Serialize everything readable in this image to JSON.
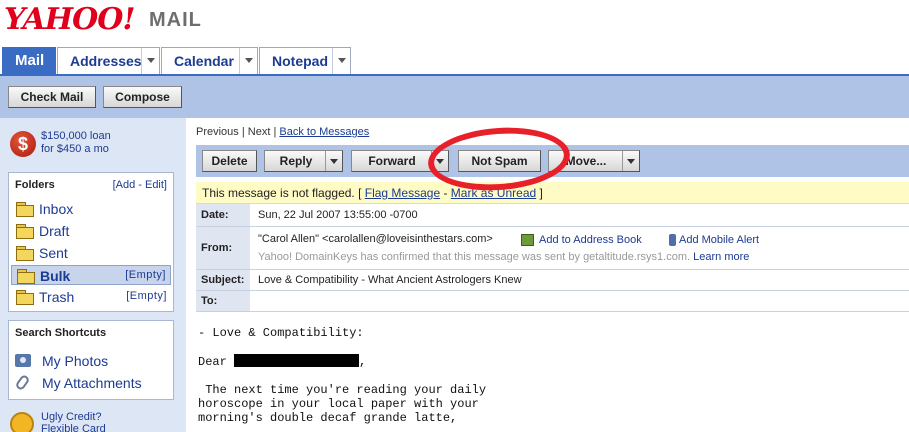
{
  "header": {
    "logo_text": "YAHOO!",
    "product": "MAIL"
  },
  "tabs": [
    {
      "label": "Mail",
      "active": true
    },
    {
      "label": "Addresses"
    },
    {
      "label": "Calendar"
    },
    {
      "label": "Notepad"
    }
  ],
  "toolbar": {
    "check_mail": "Check Mail",
    "compose": "Compose"
  },
  "sidebar": {
    "promo_top": {
      "line1": "$150,000 loan",
      "line2": "for $450 a mo",
      "icon": "dollar-icon"
    },
    "folders_title": "Folders",
    "folders_actions": "[Add - Edit]",
    "folders": [
      {
        "label": "Inbox",
        "empty": ""
      },
      {
        "label": "Draft",
        "empty": ""
      },
      {
        "label": "Sent",
        "empty": ""
      },
      {
        "label": "Bulk",
        "empty": "[Empty]",
        "selected": true
      },
      {
        "label": "Trash",
        "empty": "[Empty]"
      }
    ],
    "shortcuts_title": "Search Shortcuts",
    "shortcuts": [
      {
        "label": "My Photos",
        "icon": "camera-icon"
      },
      {
        "label": "My Attachments",
        "icon": "paperclip-icon"
      }
    ],
    "promo_bottom": {
      "line1": "Ugly Credit?",
      "line2": "Flexible Card"
    }
  },
  "nav": {
    "previous": "Previous",
    "sep1": " | ",
    "next": "Next",
    "sep2": " | ",
    "back": "Back to Messages"
  },
  "actions": {
    "delete": "Delete",
    "reply": "Reply",
    "forward": "Forward",
    "not_spam": "Not Spam",
    "move": "Move..."
  },
  "flag_bar": {
    "text": "This message is not flagged. [ ",
    "flag_link": "Flag Message",
    "dash": " - ",
    "unread_link": "Mark as Unread",
    "close": " ]"
  },
  "message": {
    "date_label": "Date:",
    "date": "Sun, 22 Jul 2007 13:55:00 -0700",
    "from_label": "From:",
    "from": "\"Carol Allen\" <carolallen@loveisinthestars.com>",
    "add_address": "Add to Address Book",
    "add_mobile": "Add Mobile Alert",
    "domainkeys_note": "Yahoo! DomainKeys has confirmed that this message was sent by getaltitude.rsys1.com.",
    "learn_more": "Learn more",
    "subject_label": "Subject:",
    "subject": "Love & Compatibility - What Ancient Astrologers Knew",
    "to_label": "To:",
    "to": ""
  },
  "body": {
    "line1": "- Love & Compatibility:",
    "dear": "Dear ",
    "dear_after": ",",
    "para": " The next time you're reading your daily\nhoroscope in your local paper with your\nmorning's double decaf grande latte,"
  },
  "colors": {
    "brand_red": "#e0001b",
    "tab_blue": "#3a6cc4",
    "band_blue": "#aec3e6",
    "link_blue": "#1c3b92",
    "annotation_red": "#e8202a"
  }
}
